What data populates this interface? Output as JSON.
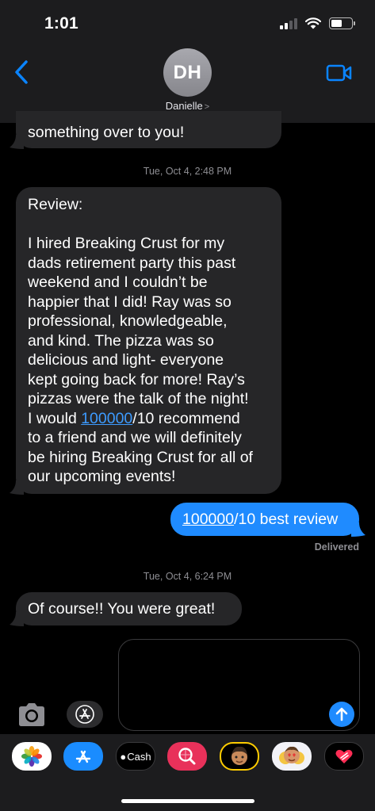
{
  "status": {
    "time": "1:01"
  },
  "header": {
    "avatar_initials": "DH",
    "contact_name": "Danielle",
    "contact_chevron": ">"
  },
  "messages": {
    "m0": {
      "line": "something over to you!"
    },
    "ts1": "Tue, Oct 4, 2:48 PM",
    "review": {
      "lines": [
        "Review:",
        "",
        "I hired Breaking Crust for my",
        "dads retirement party this past",
        "weekend and I couldn’t be",
        "happier that I did! Ray was so",
        "professional, knowledgeable,",
        "and kind. The pizza was so",
        "delicious and light- everyone",
        "kept going back for more! Ray’s",
        "pizzas were the talk of the night!"
      ],
      "l12_pre": "I would ",
      "l12_link": "100000",
      "l12_post": "/10 recommend",
      "l13": "to a friend and we will definitely",
      "l14": "be hiring Breaking Crust for all of",
      "l15": "our upcoming events!"
    },
    "sent": {
      "link": "100000",
      "rest": "/10 best review"
    },
    "delivered": "Delivered",
    "ts2": "Tue, Oct 4, 6:24 PM",
    "reply": "Of course!! You were great!"
  },
  "drawer": {
    "cash_label": "Cash"
  },
  "colors": {
    "bubble_in": "#262628",
    "bubble_out": "#1f8bff",
    "link": "#3d9bff",
    "header": "#1c1c1e"
  },
  "icons": [
    "back-chevron-icon",
    "video-call-icon",
    "camera-icon",
    "app-store-icon",
    "send-arrow-icon",
    "photos-icon",
    "apple-cash-icon",
    "search-images-icon",
    "memoji-icon",
    "heart-digital-touch-icon"
  ]
}
